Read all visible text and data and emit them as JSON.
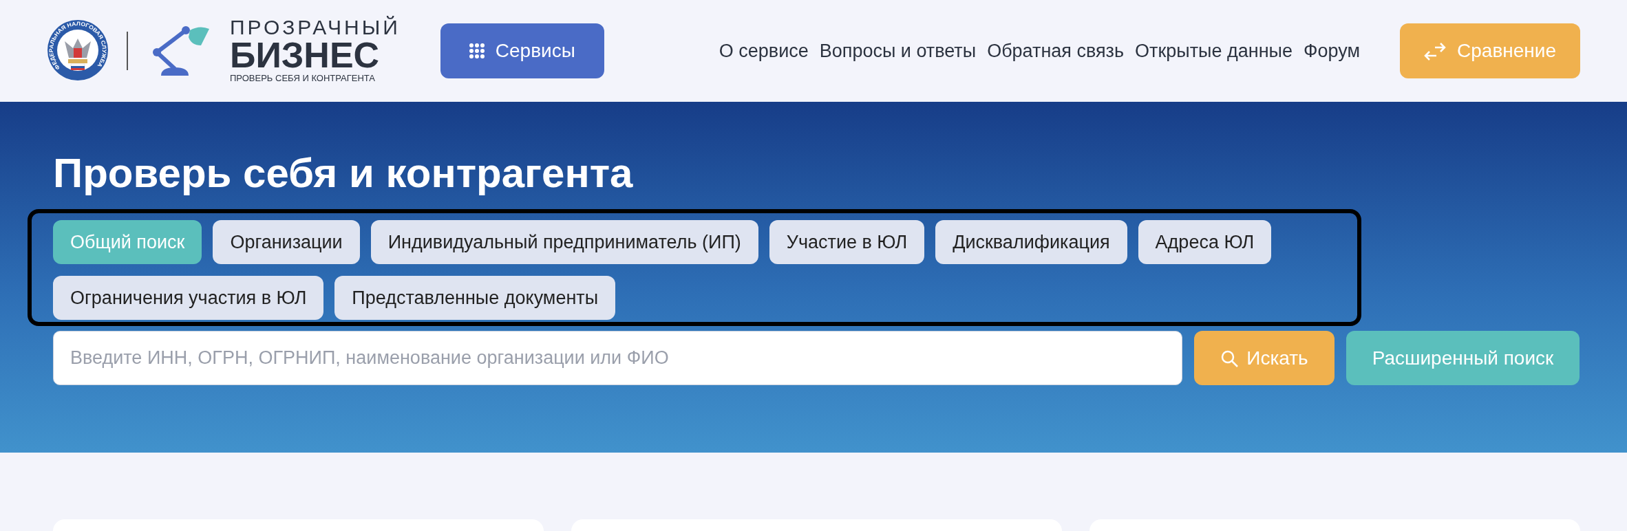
{
  "header": {
    "emblem_text": "ФЕДЕРАЛЬНАЯ НАЛОГОВАЯ СЛУЖБА",
    "brand": {
      "line_1": "ПРОЗРАЧНЫЙ",
      "line_2": "БИЗНЕС",
      "tagline": "ПРОВЕРЬ СЕБЯ И КОНТРАГЕНТА"
    },
    "services_button": "Сервисы",
    "nav": [
      "О сервисе",
      "Вопросы и ответы",
      "Обратная связь",
      "Открытые данные",
      "Форум"
    ],
    "compare_button": "Сравнение"
  },
  "hero": {
    "title": "Проверь себя и контрагента",
    "tabs": [
      {
        "label": "Общий поиск",
        "selected": true
      },
      {
        "label": "Организации",
        "selected": false
      },
      {
        "label": "Индивидуальный предприниматель (ИП)",
        "selected": false
      },
      {
        "label": "Участие в ЮЛ",
        "selected": false
      },
      {
        "label": "Дисквалификация",
        "selected": false
      },
      {
        "label": "Адреса ЮЛ",
        "selected": false
      },
      {
        "label": "Ограничения участия в ЮЛ",
        "selected": false
      },
      {
        "label": "Представленные документы",
        "selected": false
      }
    ],
    "search": {
      "placeholder": "Введите ИНН, ОГРН, ОГРНИП, наименование организации или ФИО"
    },
    "search_button": "Искать",
    "advanced_button": "Расширенный поиск"
  }
}
